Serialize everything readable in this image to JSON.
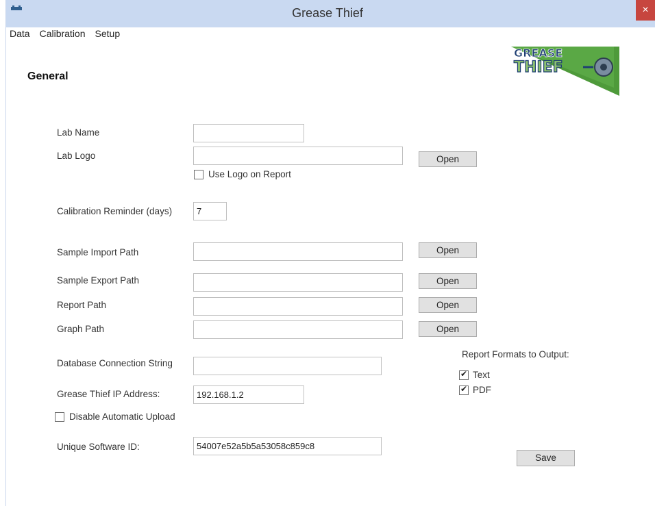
{
  "window": {
    "title": "Grease Thief",
    "close_glyph": "×"
  },
  "menu": [
    "Data",
    "Calibration",
    "Setup"
  ],
  "section_title": "General",
  "logo": {
    "line1": "GREASE",
    "line2": "THIEF",
    "colors": {
      "green": "#4e9a3a",
      "dark": "#1f3f73"
    }
  },
  "fields": {
    "lab_name": {
      "label": "Lab Name",
      "value": ""
    },
    "lab_logo": {
      "label": "Lab Logo",
      "value": ""
    },
    "use_logo": {
      "label": "Use Logo on Report",
      "checked": false
    },
    "calibration_reminder": {
      "label": "Calibration Reminder (days)",
      "value": "7"
    },
    "sample_import_path": {
      "label": "Sample Import Path",
      "value": ""
    },
    "sample_export_path": {
      "label": "Sample Export Path",
      "value": ""
    },
    "report_path": {
      "label": "Report Path",
      "value": ""
    },
    "graph_path": {
      "label": "Graph Path",
      "value": ""
    },
    "db_connection": {
      "label": "Database Connection String",
      "value": ""
    },
    "ip_address": {
      "label": "Grease Thief IP Address:",
      "value": "192.168.1.2"
    },
    "disable_upload": {
      "label": "Disable Automatic Upload",
      "checked": false
    },
    "software_id": {
      "label": "Unique Software ID:",
      "value": "54007e52a5b5a53058c859c8"
    }
  },
  "buttons": {
    "open": "Open",
    "save": "Save"
  },
  "report_formats": {
    "title": "Report Formats to Output:",
    "text": {
      "label": "Text",
      "checked": true
    },
    "pdf": {
      "label": "PDF",
      "checked": true
    }
  }
}
